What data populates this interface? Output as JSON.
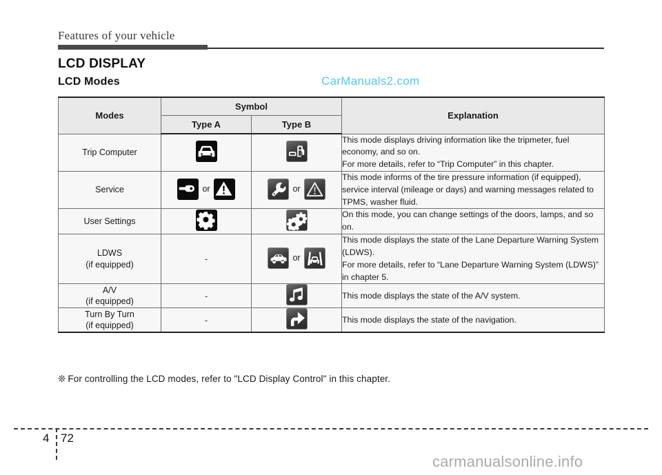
{
  "page": {
    "chapter_title": "Features of your vehicle",
    "section_title": "LCD DISPLAY",
    "subsection_title": "LCD Modes",
    "chapter_number": "4",
    "page_number": "72",
    "footnote_glyph": "❊",
    "footnote_text": "For controlling the LCD modes, refer to \"LCD Display Control\" in this chapter.",
    "watermark_top": "CarManuals2.com",
    "watermark_bottom": "carmanualsonline.info",
    "accent_watermark_color": "#55c8f0",
    "rule_color": "#2f2f2f"
  },
  "table": {
    "headers": {
      "modes": "Modes",
      "symbol": "Symbol",
      "type_a": "Type A",
      "type_b": "Type B",
      "explanation": "Explanation"
    },
    "or_label": "or",
    "empty_symbol": "-",
    "rows": [
      {
        "mode": "Trip Computer",
        "mode_note": "",
        "type_a_icons": [
          "car-front-icon"
        ],
        "type_b_icons": [
          "fuel-pump-icon"
        ],
        "explanation": "This mode displays driving information like the tripmeter, fuel economy, and so on.\nFor more details, refer to “Trip Computer” in this chapter."
      },
      {
        "mode": "Service",
        "mode_note": "",
        "type_a_icons": [
          "wrench-horizontal-icon",
          "warning-triangle-icon"
        ],
        "type_b_icons": [
          "wrench-vertical-icon",
          "warning-triangle-outline-icon"
        ],
        "explanation": "This mode informs of the tire pressure information (if equipped), service interval (mileage or days) and warning messages related to TPMS, washer fluid."
      },
      {
        "mode": "User Settings",
        "mode_note": "",
        "type_a_icons": [
          "gear-icon"
        ],
        "type_b_icons": [
          "double-gear-icon"
        ],
        "explanation": "On this mode, you can change settings of the doors, lamps, and so on."
      },
      {
        "mode": "LDWS",
        "mode_note": "(if equipped)",
        "type_a_icons": [],
        "type_b_icons": [
          "car-side-icon",
          "lane-departure-icon"
        ],
        "explanation": "This mode displays the state of the Lane Departure Warning System (LDWS).\nFor more details, refer to “Lane Departure Warning System (LDWS)” in chapter 5."
      },
      {
        "mode": "A/V",
        "mode_note": "(if equipped)",
        "type_a_icons": [],
        "type_b_icons": [
          "music-note-icon"
        ],
        "explanation": "This mode displays the state of the A/V system."
      },
      {
        "mode": "Turn By Turn",
        "mode_note": "(if equipped)",
        "type_a_icons": [],
        "type_b_icons": [
          "turn-right-arrow-icon"
        ],
        "explanation": "This mode displays the state of the navigation."
      }
    ]
  }
}
